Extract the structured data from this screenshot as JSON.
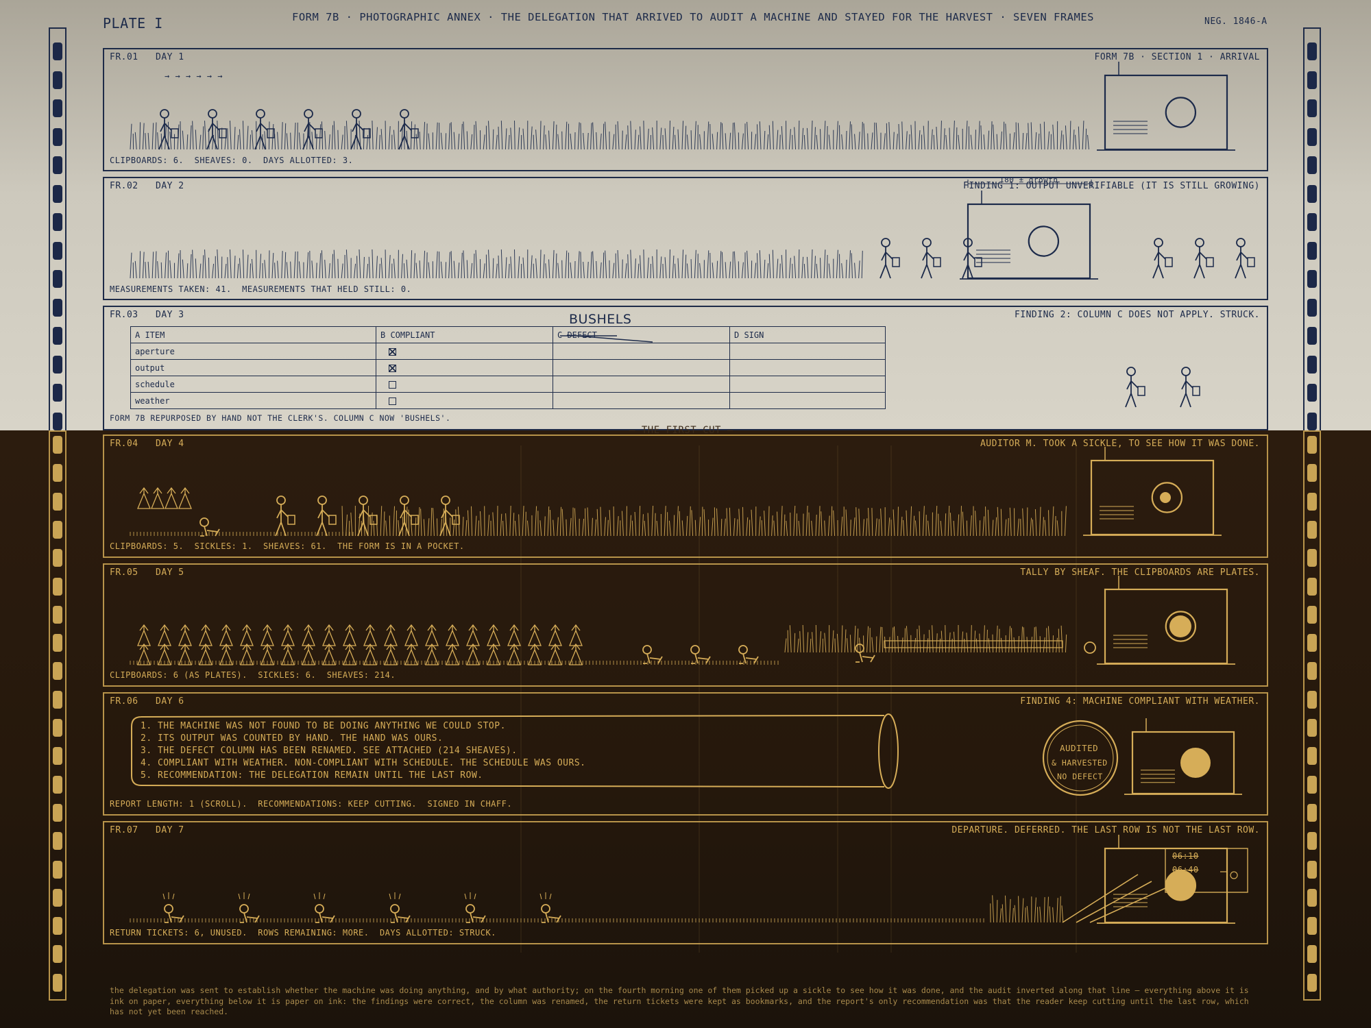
{
  "plate": "PLATE I",
  "title": "FORM 7B · PHOTOGRAPHIC ANNEX · THE DELEGATION THAT ARRIVED TO AUDIT A MACHINE AND STAYED FOR THE HARVEST · SEVEN FRAMES",
  "neg": "NEG. 1846-A",
  "colors": {
    "ink": "#1c2a4a",
    "gold": "#d6ad58",
    "paper": "#d8d4c8",
    "dark": "#241a10"
  },
  "frames": [
    {
      "id": "FR.01",
      "day": "DAY 1",
      "note": "FORM 7B · SECTION 1 · ARRIVAL",
      "caption": "CLIPBOARDS: 6.  SHEAVES: 0.  DAYS ALLOTTED: 3.",
      "arrows": "→ → → → → →"
    },
    {
      "id": "FR.02",
      "day": "DAY 2",
      "note": "FINDING 1: OUTPUT UNVERIFIABLE (IT IS STILL GROWING)",
      "caption": "MEASUREMENTS TAKEN: 41.  MEASUREMENTS THAT HELD STILL: 0.",
      "scale": "180 ± growth"
    },
    {
      "id": "FR.03",
      "day": "DAY 3",
      "note": "FINDING 2: COLUMN C DOES NOT APPLY. STRUCK.",
      "caption": "FORM 7B REPURPOSED BY HAND NOT THE CLERK'S. COLUMN C NOW 'BUSHELS'.",
      "handwritten": "BUSHELS"
    },
    {
      "id": "FR.04",
      "day": "DAY 4",
      "note": "AUDITOR M. TOOK A SICKLE, TO SEE HOW IT WAS DONE.",
      "caption": "CLIPBOARDS: 5.  SICKLES: 1.  SHEAVES: 61.  THE FORM IS IN A POCKET."
    },
    {
      "id": "FR.05",
      "day": "DAY 5",
      "note": "TALLY BY SHEAF. THE CLIPBOARDS ARE PLATES.",
      "caption": "CLIPBOARDS: 6 (AS PLATES).  SICKLES: 6.  SHEAVES: 214."
    },
    {
      "id": "FR.06",
      "day": "DAY 6",
      "note": "FINDING 4: MACHINE COMPLIANT WITH WEATHER.",
      "caption": "REPORT LENGTH: 1 (SCROLL).  RECOMMENDATIONS: KEEP CUTTING.  SIGNED IN CHAFF."
    },
    {
      "id": "FR.07",
      "day": "DAY 7",
      "note": "DEPARTURE. DEFERRED. THE LAST ROW IS NOT THE LAST ROW.",
      "caption": "RETURN TICKETS: 6, UNUSED.  ROWS REMAINING: MORE.  DAYS ALLOTTED: STRUCK."
    }
  ],
  "form_table": {
    "headers": [
      "A  ITEM",
      "B  COMPLIANT",
      "C  DEFECT",
      "D  SIGN"
    ],
    "rows": [
      {
        "item": "aperture",
        "compliant": "checked"
      },
      {
        "item": "output",
        "compliant": "checked"
      },
      {
        "item": "schedule",
        "compliant": "empty"
      },
      {
        "item": "weather",
        "compliant": "empty"
      }
    ]
  },
  "divider": "— THE FIRST CUT —",
  "scroll": [
    "1. THE MACHINE WAS NOT FOUND TO BE DOING ANYTHING WE COULD STOP.",
    "2. ITS OUTPUT WAS COUNTED BY HAND. THE HAND WAS OURS.",
    "3. THE DEFECT COLUMN HAS BEEN RENAMED. SEE ATTACHED (214 SHEAVES).",
    "4. COMPLIANT WITH WEATHER. NON-COMPLIANT WITH SCHEDULE. THE SCHEDULE WAS OURS.",
    "5. RECOMMENDATION: THE DELEGATION REMAIN UNTIL THE LAST ROW."
  ],
  "stamp": [
    "AUDITED",
    "& HARVESTED",
    "NO DEFECT"
  ],
  "tickets": [
    "06:10",
    "06:40"
  ],
  "footer": "the delegation was sent to establish whether the machine was doing anything, and by what authority; on the fourth morning one of them picked up a sickle to see how it was done, and the audit inverted along that line — everything above it is ink on paper, everything below it is paper on ink: the findings were correct, the column was renamed, the return tickets were kept as bookmarks, and the report's only recommendation was that the reader keep cutting until the last row, which has not yet been reached."
}
